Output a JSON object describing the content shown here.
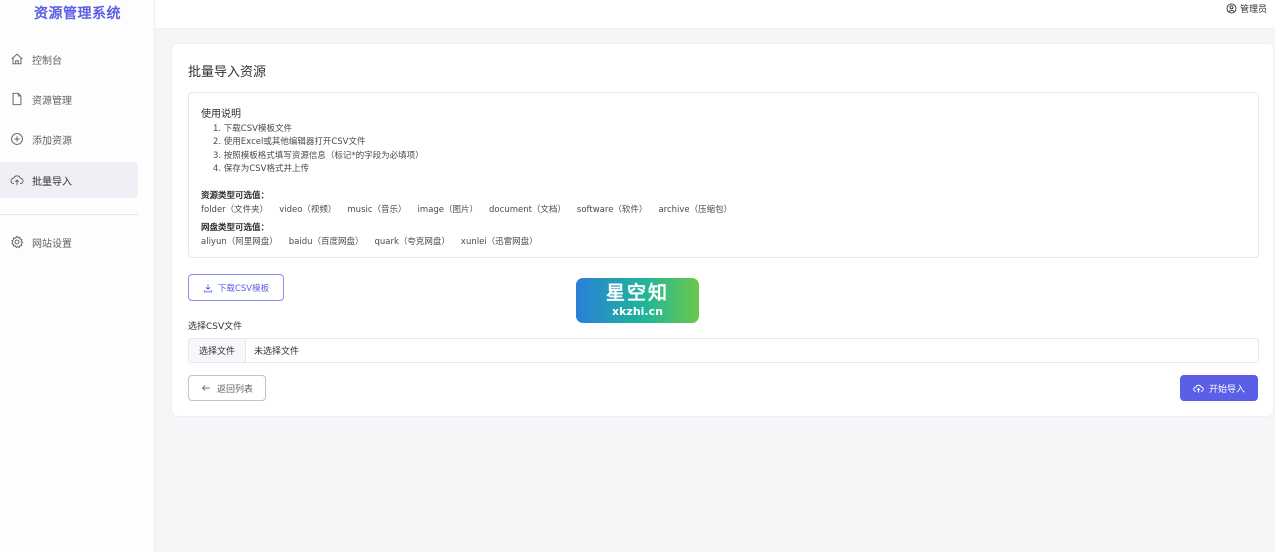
{
  "sidebar": {
    "brand": "资源管理系统",
    "items": [
      {
        "label": "控制台",
        "icon": "home-icon"
      },
      {
        "label": "资源管理",
        "icon": "file-icon"
      },
      {
        "label": "添加资源",
        "icon": "plus-circle-icon"
      },
      {
        "label": "批量导入",
        "icon": "cloud-upload-icon",
        "active": true
      },
      {
        "label": "网站设置",
        "icon": "gear-icon"
      }
    ]
  },
  "header": {
    "user": "管理员",
    "user_icon": "user-circle-icon"
  },
  "main": {
    "title": "批量导入资源",
    "instructions": {
      "heading": "使用说明",
      "steps": [
        "1. 下载CSV模板文件",
        "2. 使用Excel或其他编辑器打开CSV文件",
        "3. 按照模板格式填写资源信息（标记*的字段为必填项）",
        "4. 保存为CSV格式并上传"
      ],
      "resource_types_heading": "资源类型可选值：",
      "resource_types": [
        "folder（文件夹）",
        "video（视频）",
        "music（音乐）",
        "image（图片）",
        "document（文档）",
        "software（软件）",
        "archive（压缩包）"
      ],
      "disk_types_heading": "网盘类型可选值：",
      "disk_types": [
        "aliyun（阿里网盘）",
        "baidu（百度网盘）",
        "quark（夸克网盘）",
        "xunlei（迅雷网盘）"
      ]
    },
    "download_button": "下载CSV模板",
    "file_label": "选择CSV文件",
    "file_button": "选择文件",
    "file_status": "未选择文件",
    "back_button": "返回列表",
    "start_button": "开始导入"
  },
  "watermark": {
    "main": "星空知",
    "sub": "xkzhi.cn"
  },
  "colors": {
    "accent": "#5b5fe6",
    "background": "#f5f6f8"
  }
}
